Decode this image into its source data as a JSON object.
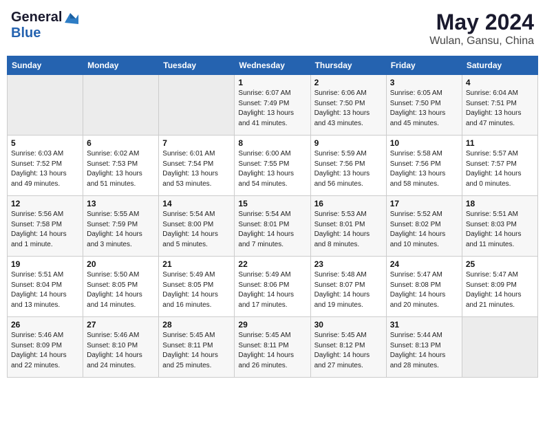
{
  "header": {
    "logo_general": "General",
    "logo_blue": "Blue",
    "month": "May 2024",
    "location": "Wulan, Gansu, China"
  },
  "weekdays": [
    "Sunday",
    "Monday",
    "Tuesday",
    "Wednesday",
    "Thursday",
    "Friday",
    "Saturday"
  ],
  "weeks": [
    [
      {
        "day": "",
        "info": ""
      },
      {
        "day": "",
        "info": ""
      },
      {
        "day": "",
        "info": ""
      },
      {
        "day": "1",
        "info": "Sunrise: 6:07 AM\nSunset: 7:49 PM\nDaylight: 13 hours and 41 minutes."
      },
      {
        "day": "2",
        "info": "Sunrise: 6:06 AM\nSunset: 7:50 PM\nDaylight: 13 hours and 43 minutes."
      },
      {
        "day": "3",
        "info": "Sunrise: 6:05 AM\nSunset: 7:50 PM\nDaylight: 13 hours and 45 minutes."
      },
      {
        "day": "4",
        "info": "Sunrise: 6:04 AM\nSunset: 7:51 PM\nDaylight: 13 hours and 47 minutes."
      }
    ],
    [
      {
        "day": "5",
        "info": "Sunrise: 6:03 AM\nSunset: 7:52 PM\nDaylight: 13 hours and 49 minutes."
      },
      {
        "day": "6",
        "info": "Sunrise: 6:02 AM\nSunset: 7:53 PM\nDaylight: 13 hours and 51 minutes."
      },
      {
        "day": "7",
        "info": "Sunrise: 6:01 AM\nSunset: 7:54 PM\nDaylight: 13 hours and 53 minutes."
      },
      {
        "day": "8",
        "info": "Sunrise: 6:00 AM\nSunset: 7:55 PM\nDaylight: 13 hours and 54 minutes."
      },
      {
        "day": "9",
        "info": "Sunrise: 5:59 AM\nSunset: 7:56 PM\nDaylight: 13 hours and 56 minutes."
      },
      {
        "day": "10",
        "info": "Sunrise: 5:58 AM\nSunset: 7:56 PM\nDaylight: 13 hours and 58 minutes."
      },
      {
        "day": "11",
        "info": "Sunrise: 5:57 AM\nSunset: 7:57 PM\nDaylight: 14 hours and 0 minutes."
      }
    ],
    [
      {
        "day": "12",
        "info": "Sunrise: 5:56 AM\nSunset: 7:58 PM\nDaylight: 14 hours and 1 minute."
      },
      {
        "day": "13",
        "info": "Sunrise: 5:55 AM\nSunset: 7:59 PM\nDaylight: 14 hours and 3 minutes."
      },
      {
        "day": "14",
        "info": "Sunrise: 5:54 AM\nSunset: 8:00 PM\nDaylight: 14 hours and 5 minutes."
      },
      {
        "day": "15",
        "info": "Sunrise: 5:54 AM\nSunset: 8:01 PM\nDaylight: 14 hours and 7 minutes."
      },
      {
        "day": "16",
        "info": "Sunrise: 5:53 AM\nSunset: 8:01 PM\nDaylight: 14 hours and 8 minutes."
      },
      {
        "day": "17",
        "info": "Sunrise: 5:52 AM\nSunset: 8:02 PM\nDaylight: 14 hours and 10 minutes."
      },
      {
        "day": "18",
        "info": "Sunrise: 5:51 AM\nSunset: 8:03 PM\nDaylight: 14 hours and 11 minutes."
      }
    ],
    [
      {
        "day": "19",
        "info": "Sunrise: 5:51 AM\nSunset: 8:04 PM\nDaylight: 14 hours and 13 minutes."
      },
      {
        "day": "20",
        "info": "Sunrise: 5:50 AM\nSunset: 8:05 PM\nDaylight: 14 hours and 14 minutes."
      },
      {
        "day": "21",
        "info": "Sunrise: 5:49 AM\nSunset: 8:05 PM\nDaylight: 14 hours and 16 minutes."
      },
      {
        "day": "22",
        "info": "Sunrise: 5:49 AM\nSunset: 8:06 PM\nDaylight: 14 hours and 17 minutes."
      },
      {
        "day": "23",
        "info": "Sunrise: 5:48 AM\nSunset: 8:07 PM\nDaylight: 14 hours and 19 minutes."
      },
      {
        "day": "24",
        "info": "Sunrise: 5:47 AM\nSunset: 8:08 PM\nDaylight: 14 hours and 20 minutes."
      },
      {
        "day": "25",
        "info": "Sunrise: 5:47 AM\nSunset: 8:09 PM\nDaylight: 14 hours and 21 minutes."
      }
    ],
    [
      {
        "day": "26",
        "info": "Sunrise: 5:46 AM\nSunset: 8:09 PM\nDaylight: 14 hours and 22 minutes."
      },
      {
        "day": "27",
        "info": "Sunrise: 5:46 AM\nSunset: 8:10 PM\nDaylight: 14 hours and 24 minutes."
      },
      {
        "day": "28",
        "info": "Sunrise: 5:45 AM\nSunset: 8:11 PM\nDaylight: 14 hours and 25 minutes."
      },
      {
        "day": "29",
        "info": "Sunrise: 5:45 AM\nSunset: 8:11 PM\nDaylight: 14 hours and 26 minutes."
      },
      {
        "day": "30",
        "info": "Sunrise: 5:45 AM\nSunset: 8:12 PM\nDaylight: 14 hours and 27 minutes."
      },
      {
        "day": "31",
        "info": "Sunrise: 5:44 AM\nSunset: 8:13 PM\nDaylight: 14 hours and 28 minutes."
      },
      {
        "day": "",
        "info": ""
      }
    ]
  ]
}
